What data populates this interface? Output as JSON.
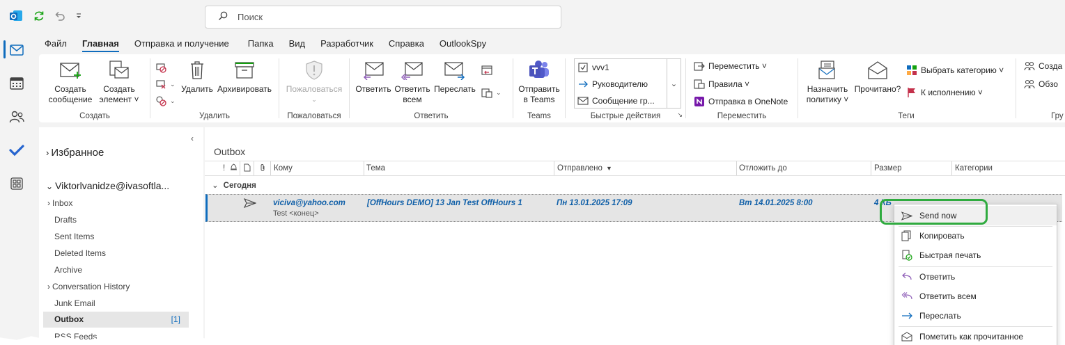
{
  "search": {
    "placeholder": "Поиск"
  },
  "menu_tabs": [
    "Файл",
    "Главная",
    "Отправка и получение",
    "Папка",
    "Вид",
    "Разработчик",
    "Справка",
    "OutlookSpy"
  ],
  "ribbon": {
    "create": {
      "label": "Создать",
      "new_message": "Создать\nсообщение",
      "new_item": "Создать\nэлемент ˅"
    },
    "delete": {
      "label": "Удалить",
      "delete_btn": "Удалить",
      "archive_btn": "Архивировать"
    },
    "report": {
      "label": "Пожаловаться",
      "report_btn": "Пожаловаться"
    },
    "respond": {
      "label": "Ответить",
      "reply": "Ответить",
      "reply_all": "Ответить\nвсем",
      "forward": "Переслать"
    },
    "teams": {
      "label": "Teams",
      "send_teams": "Отправить\nв Teams"
    },
    "quick": {
      "label": "Быстрые действия",
      "item1": "vvv1",
      "item2": "Руководителю",
      "item3": "Сообщение гр..."
    },
    "move": {
      "label": "Переместить",
      "move_btn": "Переместить ˅",
      "rules_btn": "Правила ˅",
      "onenote_btn": "Отправка в OneNote"
    },
    "tags": {
      "label": "Теги",
      "policy": "Назначить\nполитику ˅",
      "read": "Прочитано?",
      "category": "Выбрать категорию ˅",
      "followup": "К исполнению ˅"
    },
    "groups": {
      "label": "Гру",
      "create": "Созда",
      "browse": "Обзо"
    }
  },
  "folders": {
    "favorites": "Избранное",
    "account": "Viktorlvanidze@ivasoftla...",
    "items": [
      "Inbox",
      "Drafts",
      "Sent Items",
      "Deleted Items",
      "Archive",
      "Conversation History",
      "Junk Email",
      "Outbox",
      "RSS Feeds"
    ],
    "outbox_count": "[1]"
  },
  "message_list": {
    "title": "Outbox",
    "columns": [
      "!",
      "Кому",
      "Тема",
      "Отправлено",
      "Отложить до",
      "Размер",
      "Категории"
    ],
    "group": "Сегодня",
    "row": {
      "to": "viciva@yahoo.com",
      "subject": "[OffHours DEMO] 13 Jan Test OffHours 1",
      "sent": "Пн 13.01.2025 17:09",
      "defer": "Вт 14.01.2025 8:00",
      "size": "4 КБ",
      "preview": "Test <конец>"
    }
  },
  "context_menu": {
    "send_now": "Send now",
    "copy": "Копировать",
    "quick_print": "Быстрая печать",
    "reply": "Ответить",
    "reply_all": "Ответить всем",
    "forward": "Переслать",
    "mark_read": "Пометить как прочитанное"
  },
  "colors": {
    "accent": "#0f6cbd",
    "highlight": "#2fab3f"
  }
}
